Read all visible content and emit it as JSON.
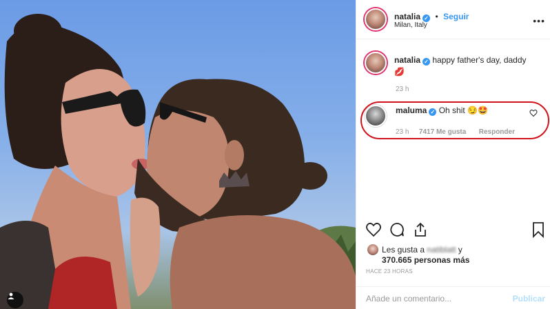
{
  "post": {
    "author": "natalia",
    "follow_label": "Seguir",
    "location": "Milan, Italy",
    "more_icon": "more-options-icon"
  },
  "caption": {
    "username": "natalia",
    "text": "happy father's day, daddy",
    "emoji": "💋",
    "time": "23 h"
  },
  "comment": {
    "username": "maluma",
    "text": "Oh shit",
    "emoji": "😏🤩",
    "time": "23 h",
    "likes": "7417 Me gusta",
    "reply_label": "Responder"
  },
  "likes": {
    "prefix": "Les gusta a",
    "user": "natiblatt",
    "suffix": "y",
    "count_text": "370.665 personas más"
  },
  "posted_ago": "HACE 23 HORAS",
  "add_comment": {
    "placeholder": "Añade un comentario...",
    "publish_label": "Publicar"
  },
  "colors": {
    "accent": "#3897f0",
    "highlight": "#d0121c",
    "muted": "#999999"
  }
}
